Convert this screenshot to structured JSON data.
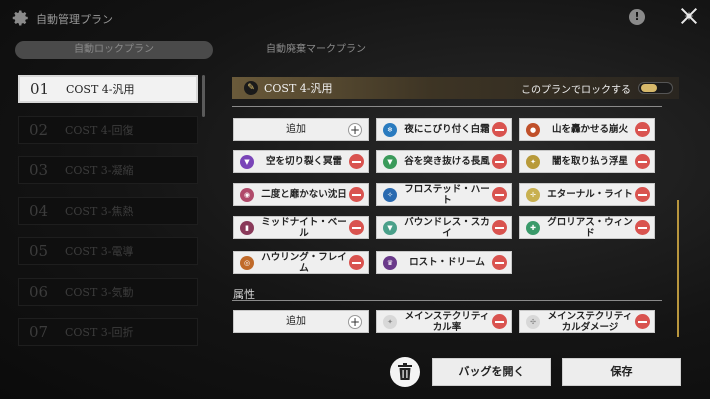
{
  "header": {
    "title": "自動管理プラン",
    "info_glyph": "!"
  },
  "tabs": [
    {
      "label": "自動ロックプラン"
    },
    {
      "label": "自動廃棄マークプラン"
    }
  ],
  "plans": [
    {
      "num": "01",
      "label": "COST 4-汎用"
    },
    {
      "num": "02",
      "label": "COST 4-回復"
    },
    {
      "num": "03",
      "label": "COST 3-凝縮"
    },
    {
      "num": "04",
      "label": "COST 3-焦熱"
    },
    {
      "num": "05",
      "label": "COST 3-電導"
    },
    {
      "num": "06",
      "label": "COST 3-気動"
    },
    {
      "num": "07",
      "label": "COST 3-回折"
    }
  ],
  "main": {
    "title": "COST 4-汎用",
    "lock_label": "このプランでロックする",
    "lock_enabled": true,
    "add_label": "追加",
    "sets": [
      {
        "label": "夜にこびり付く白霜",
        "icon": "frost-icon",
        "color": "#2a7bbf"
      },
      {
        "label": "山を轟かせる崩火",
        "icon": "fire-icon",
        "color": "#c0502a"
      },
      {
        "label": "空を切り裂く冥雷",
        "icon": "thunder-icon",
        "color": "#7a45b8"
      },
      {
        "label": "谷を突き抜ける長風",
        "icon": "wind-icon",
        "color": "#3a9a5a"
      },
      {
        "label": "闇を取り払う浮星",
        "icon": "star-icon",
        "color": "#b89a3a"
      },
      {
        "label": "二度と靡かない沈日",
        "icon": "sun-icon",
        "color": "#b04a6a"
      },
      {
        "label": "フロステッド・ハート",
        "icon": "heart-icon",
        "color": "#2a6ab0"
      },
      {
        "label": "エターナル・ライト",
        "icon": "light-icon",
        "color": "#c8b050"
      },
      {
        "label": "ミッドナイト・ベール",
        "icon": "veil-icon",
        "color": "#8a3a5a"
      },
      {
        "label": "バウンドレス・スカイ",
        "icon": "sky-icon",
        "color": "#4aa08a"
      },
      {
        "label": "グロリアス・ウィンド",
        "icon": "glory-wind-icon",
        "color": "#3a9a6a"
      },
      {
        "label": "ハウリング・フレイム",
        "icon": "flame-icon",
        "color": "#c06a2a"
      },
      {
        "label": "ロスト・ドリーム",
        "icon": "dream-icon",
        "color": "#6a3a8a"
      }
    ],
    "attribute_section": "属性",
    "attributes": [
      {
        "label": "メインステクリティカル率",
        "icon": "crit-rate-icon"
      },
      {
        "label": "メインステクリティカルダメージ",
        "icon": "crit-dmg-icon"
      }
    ]
  },
  "footer": {
    "bag_label": "バッグを開く",
    "save_label": "保存"
  }
}
